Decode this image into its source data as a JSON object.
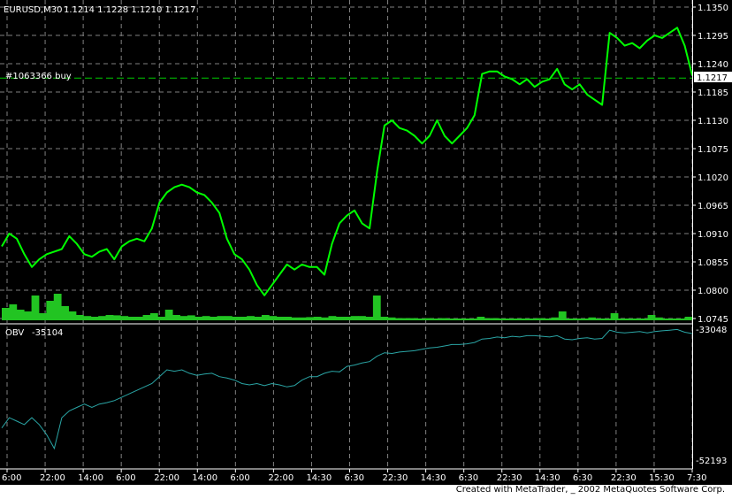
{
  "window": {
    "symbol_label": "EURUSD,M30",
    "ohlc_text": "1.1214 1.1228 1.1210 1.1217",
    "order_label": "#1063366 buy",
    "bid_label": "1.1217",
    "obv_label": "OBV",
    "obv_value_text": "-35104",
    "footer": "Created with MetaTrader, _ 2002 MetaQuotes Software Corp."
  },
  "colors": {
    "background": "#000000",
    "price_line": "#00ff00",
    "volume_bars": "#22c422",
    "obv_line": "#2aa5a5",
    "order_line": "#00cc00",
    "grid": "#808080",
    "text": "#ffffff"
  },
  "chart_data": [
    {
      "type": "line",
      "title": "EURUSD,M30",
      "ylim": [
        1.0745,
        1.135
      ],
      "y_ticks": [
        "1.1350",
        "1.1295",
        "1.1240",
        "1.1185",
        "1.1130",
        "1.1075",
        "1.1020",
        "1.0965",
        "1.0910",
        "1.0855",
        "1.0800",
        "1.0745"
      ],
      "x_ticks": [
        "6:00",
        "22:00",
        "14:00",
        "6:00",
        "22:00",
        "14:00",
        "6:00",
        "22:00",
        "14:30",
        "6:30",
        "22:30",
        "14:30",
        "6:30",
        "22:30",
        "14:30",
        "6:30",
        "22:30",
        "15:30",
        "7:30"
      ],
      "order_level": 1.1212,
      "series": [
        {
          "values": [
            1.0885,
            1.091,
            1.09,
            1.087,
            1.0845,
            1.086,
            1.087,
            1.0875,
            1.088,
            1.0905,
            1.089,
            1.087,
            1.0865,
            1.0875,
            1.088,
            1.086,
            1.0885,
            1.0895,
            1.09,
            1.0895,
            1.092,
            1.097,
            1.099,
            1.1,
            1.1005,
            1.1,
            1.099,
            1.0985,
            1.097,
            1.095,
            1.09,
            1.087,
            1.086,
            1.084,
            1.081,
            1.079,
            1.081,
            1.083,
            1.085,
            1.084,
            1.085,
            1.0845,
            1.0845,
            1.083,
            1.089,
            1.093,
            1.0945,
            1.0955,
            1.093,
            1.092,
            1.103,
            1.112,
            1.113,
            1.1115,
            1.111,
            1.11,
            1.1085,
            1.11,
            1.113,
            1.11,
            1.1085,
            1.11,
            1.1115,
            1.114,
            1.122,
            1.1225,
            1.1225,
            1.1215,
            1.121,
            1.12,
            1.121,
            1.1195,
            1.1205,
            1.121,
            1.123,
            1.12,
            1.119,
            1.12,
            1.118,
            1.117,
            1.116,
            1.13,
            1.129,
            1.1275,
            1.128,
            1.127,
            1.1285,
            1.1295,
            1.129,
            1.13,
            1.131,
            1.1275,
            1.1217
          ]
        }
      ],
      "volume": [
        0.35,
        0.45,
        0.3,
        0.25,
        0.7,
        0.2,
        0.55,
        0.75,
        0.4,
        0.25,
        0.15,
        0.12,
        0.1,
        0.12,
        0.15,
        0.14,
        0.12,
        0.1,
        0.1,
        0.15,
        0.2,
        0.1,
        0.3,
        0.15,
        0.12,
        0.14,
        0.1,
        0.12,
        0.1,
        0.12,
        0.12,
        0.1,
        0.1,
        0.12,
        0.1,
        0.15,
        0.12,
        0.1,
        0.1,
        0.08,
        0.08,
        0.09,
        0.1,
        0.08,
        0.12,
        0.1,
        0.1,
        0.12,
        0.12,
        0.1,
        0.7,
        0.1,
        0.08,
        0.06,
        0.06,
        0.06,
        0.05,
        0.06,
        0.05,
        0.06,
        0.05,
        0.05,
        0.05,
        0.05,
        0.1,
        0.06,
        0.06,
        0.05,
        0.05,
        0.05,
        0.05,
        0.05,
        0.06,
        0.05,
        0.08,
        0.25,
        0.05,
        0.05,
        0.05,
        0.08,
        0.05,
        0.05,
        0.2,
        0.05,
        0.05,
        0.05,
        0.05,
        0.15,
        0.08,
        0.05,
        0.05,
        0.05,
        0.1
      ]
    },
    {
      "type": "line",
      "title": "OBV",
      "ylim": [
        -52193,
        -33048
      ],
      "y_ticks": [
        "-33048",
        "-52193"
      ],
      "series": [
        {
          "values": [
            -47500,
            -46000,
            -46500,
            -47000,
            -46000,
            -47000,
            -48500,
            -50500,
            -46000,
            -45000,
            -44500,
            -44000,
            -44500,
            -44000,
            -43800,
            -43500,
            -43000,
            -42500,
            -42000,
            -41500,
            -41000,
            -40000,
            -39000,
            -39200,
            -39000,
            -39500,
            -39800,
            -39600,
            -39500,
            -40000,
            -40200,
            -40500,
            -41000,
            -41200,
            -41000,
            -41300,
            -41000,
            -41200,
            -41500,
            -41300,
            -40500,
            -40000,
            -40000,
            -39500,
            -39200,
            -39300,
            -38500,
            -38300,
            -38000,
            -37800,
            -37000,
            -36500,
            -36600,
            -36400,
            -36300,
            -36200,
            -36000,
            -35800,
            -35700,
            -35500,
            -35300,
            -35300,
            -35200,
            -35000,
            -34500,
            -34400,
            -34200,
            -34300,
            -34100,
            -34200,
            -34000,
            -34000,
            -34100,
            -34200,
            -34000,
            -34500,
            -34600,
            -34400,
            -34300,
            -34500,
            -34400,
            -33200,
            -33500,
            -33600,
            -33500,
            -33400,
            -33600,
            -33400,
            -33300,
            -33200,
            -33100,
            -33500,
            -33700
          ]
        }
      ]
    }
  ]
}
